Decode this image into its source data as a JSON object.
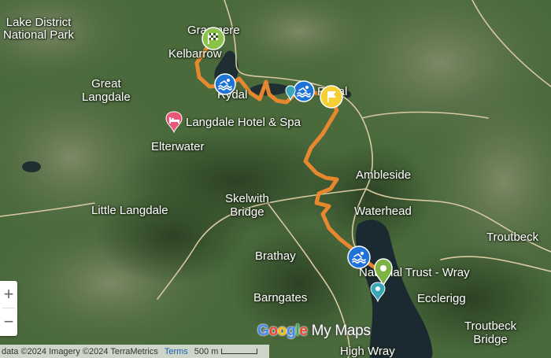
{
  "places": {
    "lake_district": "Lake District\nNational Park",
    "grasmere": "Grasmere",
    "kelbarrow": "Kelbarrow",
    "great_langdale": "Great\nLangdale",
    "rydal_water": "Rydal",
    "rydal": "Rydal",
    "langdale_hotel": "Langdale Hotel & Spa",
    "elterwater": "Elterwater",
    "ambleside": "Ambleside",
    "skelwith_bridge": "Skelwith\nBridge",
    "little_langdale": "Little Langdale",
    "waterhead": "Waterhead",
    "troutbeck": "Troutbeck",
    "brathay": "Brathay",
    "national_trust_wray": "National Trust - Wray",
    "barngates": "Barngates",
    "ecclerigg": "Ecclerigg",
    "troutbeck_bridge": "Troutbeck\nBridge",
    "high_wray": "High Wray"
  },
  "controls": {
    "zoom_in": "+",
    "zoom_out": "−"
  },
  "attribution": {
    "text": "data ©2024 Imagery ©2024 TerraMetrics",
    "terms": "Terms",
    "scale": "500 m"
  },
  "logo": {
    "g": "G",
    "o1": "o",
    "o2": "o",
    "g2": "g",
    "l": "l",
    "e": "e",
    "my_maps": "My Maps"
  },
  "colors": {
    "route": "#ef8a2e",
    "swim_marker": "#1f72d6",
    "start_marker": "#8bc34a",
    "waypoint_marker": "#f4d034",
    "end_marker": "#7cb342",
    "hotel_marker": "#e8577a",
    "road": "#d9c9a2"
  },
  "markers": [
    {
      "name": "finish-flag",
      "icon": "checkered-flag-icon"
    },
    {
      "name": "swim-rydal-1",
      "icon": "swimmer-icon"
    },
    {
      "name": "swim-rydal-2",
      "icon": "swimmer-icon"
    },
    {
      "name": "rydal-waypoint",
      "icon": "flag-icon"
    },
    {
      "name": "swim-windermere",
      "icon": "swimmer-icon"
    },
    {
      "name": "start-pin",
      "icon": "pin-icon"
    },
    {
      "name": "hotel",
      "icon": "bed-icon"
    }
  ]
}
